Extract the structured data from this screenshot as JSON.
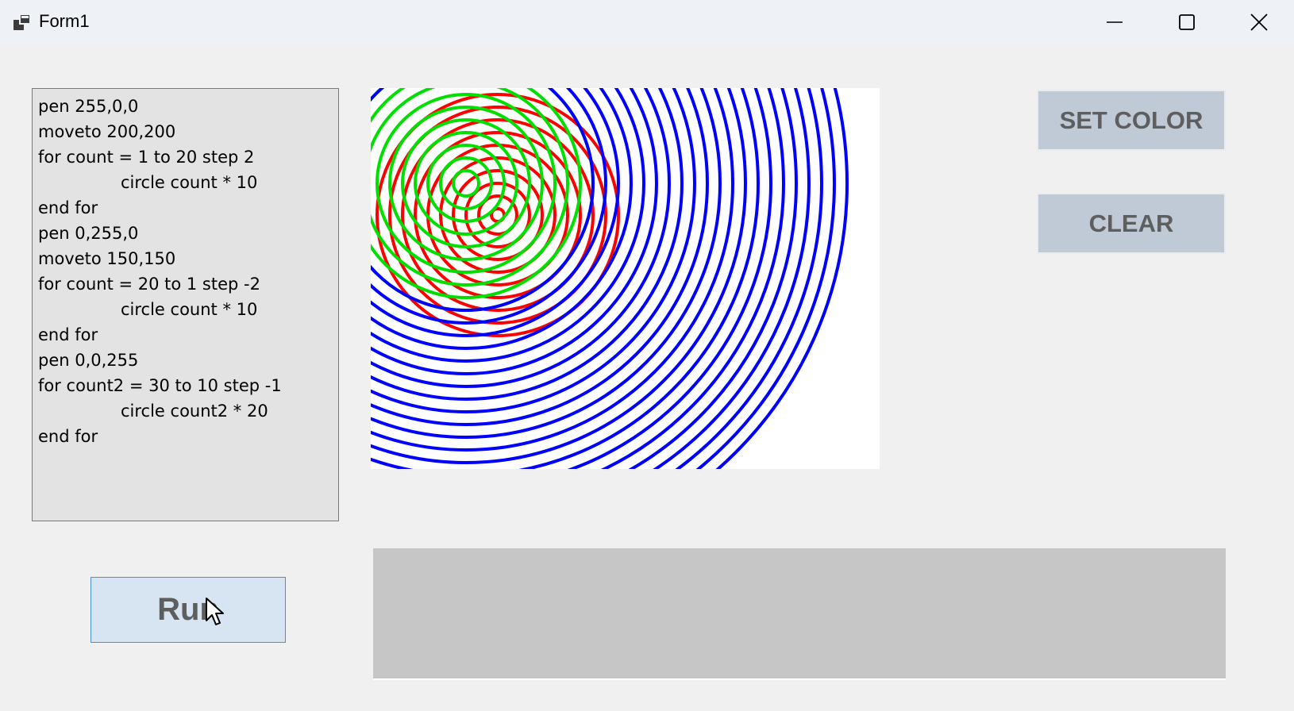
{
  "window": {
    "title": "Form1",
    "controls": [
      "minimize",
      "maximize",
      "close"
    ]
  },
  "editor": {
    "lines": [
      {
        "text": "pen 255,0,0",
        "indent": false
      },
      {
        "text": "moveto 200,200",
        "indent": false
      },
      {
        "text": "for count = 1 to 20 step 2",
        "indent": false
      },
      {
        "text": "circle count * 10",
        "indent": true
      },
      {
        "text": "end for",
        "indent": false
      },
      {
        "text": "pen 0,255,0",
        "indent": false
      },
      {
        "text": "moveto 150,150",
        "indent": false
      },
      {
        "text": "for count = 20 to 1 step -2",
        "indent": false
      },
      {
        "text": "circle count * 10",
        "indent": true
      },
      {
        "text": "end for",
        "indent": false
      },
      {
        "text": "pen 0,0,255",
        "indent": false
      },
      {
        "text": "for count2 = 30 to 10 step -1",
        "indent": false
      },
      {
        "text": "circle count2 * 20",
        "indent": true
      },
      {
        "text": "end for",
        "indent": false
      }
    ]
  },
  "buttons": {
    "set_color": "SET COLOR",
    "clear": "CLEAR",
    "run": "Run"
  },
  "output": {
    "text": ""
  },
  "colors": {
    "red_pen": "#ff0000",
    "green_pen": "#00e000",
    "blue_pen": "#0000ff",
    "button_fill": "#bfcad6",
    "run_fill": "#d7e5f3"
  },
  "icons": [
    "app-icon",
    "minimize-icon",
    "maximize-icon",
    "close-icon",
    "mouse-cursor-icon"
  ]
}
